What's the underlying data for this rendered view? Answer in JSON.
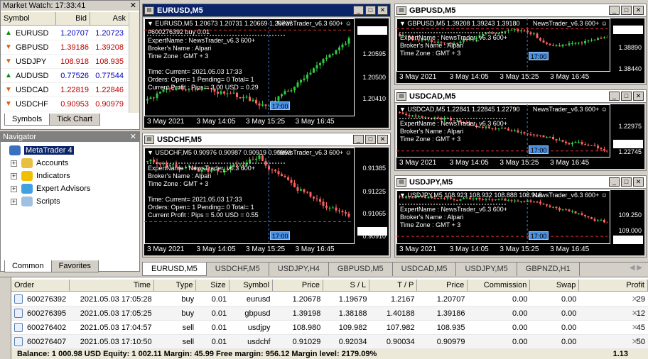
{
  "market_watch": {
    "title": "Market Watch: 17:33:41",
    "cols": {
      "symbol": "Symbol",
      "bid": "Bid",
      "ask": "Ask"
    },
    "rows": [
      {
        "symbol": "EURUSD",
        "bid": "1.20707",
        "ask": "1.20723",
        "dir": "up",
        "color": "#0000c0"
      },
      {
        "symbol": "GBPUSD",
        "bid": "1.39186",
        "ask": "1.39208",
        "dir": "down",
        "color": "#c00000"
      },
      {
        "symbol": "USDJPY",
        "bid": "108.918",
        "ask": "108.935",
        "dir": "down",
        "color": "#c00000"
      },
      {
        "symbol": "AUDUSD",
        "bid": "0.77526",
        "ask": "0.77544",
        "dir": "up",
        "color": "#0000c0"
      },
      {
        "symbol": "USDCAD",
        "bid": "1.22819",
        "ask": "1.22846",
        "dir": "down",
        "color": "#c00000"
      },
      {
        "symbol": "USDCHF",
        "bid": "0.90953",
        "ask": "0.90979",
        "dir": "down",
        "color": "#c00000"
      }
    ],
    "tabs": [
      "Symbols",
      "Tick Chart"
    ]
  },
  "navigator": {
    "title": "Navigator",
    "root": "MetaTrader 4",
    "items": [
      "Accounts",
      "Indicators",
      "Expert Advisors",
      "Scripts"
    ],
    "tabs": [
      "Common",
      "Favorites"
    ]
  },
  "charts": {
    "eurusd": {
      "title": "EURUSD,M5",
      "hdr": "EURUSD,M5  1.20673 1.20731 1.20669 1.20707",
      "ea": "NewsTrader_v6.3 600+ ☺",
      "order": "#600276392 buy 0.01",
      "lines": [
        "ExpertName : NewsTrader_v6.3 600+",
        "Broker's Name :  Alpari",
        "Time Zone : GMT + 3",
        "",
        "Time: Current= 2021.05.03 17:33",
        "Orders: Open= 1 Pending= 0 Total= 1",
        "Current Profit :  Pips = 3.00 USD = 0.29"
      ],
      "prices": [
        "1.20707",
        "1.20595",
        "1.20500",
        "1.20410"
      ],
      "tag": "17:00",
      "x": [
        "3 May 2021",
        "3 May 14:05",
        "3 May 15:25",
        "3 May 16:45"
      ]
    },
    "usdchf": {
      "title": "USDCHF,M5",
      "hdr": "USDCHF,M5  0.90976 0.90987 0.90919 0.90953",
      "ea": "NewsTrader_v6.3 600+ ☺",
      "lines": [
        "ExpertName : NewsTrader_v6.3 600+",
        "Broker's Name :  Alpari",
        "Time Zone : GMT + 3",
        "",
        "Time: Current= 2021.05.03 17:33",
        "Orders: Open= 1 Pending= 0 Total= 1",
        "Current Profit :  Pips = 5.00 USD = 0.55"
      ],
      "prices": [
        "0.91385",
        "0.91225",
        "0.91065",
        "0.90953",
        "0.90910"
      ],
      "tag": "17:00",
      "x": [
        "3 May 2021",
        "3 May 14:05",
        "3 May 15:25",
        "3 May 16:45"
      ]
    },
    "gbpusd": {
      "title": "GBPUSD,M5",
      "hdr": "GBPUSD,M5  1.39208 1.39243 1.39180",
      "ea": "NewsTrader_v6.3 600+ ☺",
      "lines": [
        "ExpertName : NewsTrader_v6.3 600+",
        "Broker's Name :  Alpari",
        "Time Zone : GMT + 3"
      ],
      "prices": [
        "1.39186",
        "1.38890",
        "1.38440"
      ],
      "tag": "17:00",
      "x": [
        "3 May 2021",
        "3 May 14:05",
        "3 May 15:25",
        "3 May 16:45"
      ]
    },
    "usdcad": {
      "title": "USDCAD,M5",
      "hdr": "USDCAD,M5  1.22841 1.22845 1.22790",
      "ea": "NewsTrader_v6.3 600+ ☺",
      "lines": [
        "ExpertName : NewsTrader_v6.3 600+",
        "Broker's Name :  Alpari",
        "Time Zone : GMT + 3"
      ],
      "prices": [
        "1.22975",
        "1.22819",
        "1.22745"
      ],
      "tag": "17:00",
      "x": [
        "3 May 2021",
        "3 May 14:05",
        "3 May 15:25",
        "3 May 16:45"
      ]
    },
    "usdjpy": {
      "title": "USDJPY,M5",
      "hdr": "USDJPY,M5  108.923 108.932 108.888 108.918",
      "ea": "NewsTrader_v6.3 600+ ☺",
      "lines": [
        "ExpertName : NewsTrader_v6.3 600+",
        "Broker's Name :  Alpari",
        "Time Zone : GMT + 3"
      ],
      "prices": [
        "109.250",
        "109.000",
        "108.918"
      ],
      "tag": "17:00",
      "x": [
        "3 May 2021",
        "3 May 14:05",
        "3 May 15:25",
        "3 May 16:45"
      ]
    }
  },
  "chart_tabs": [
    "EURUSD,M5",
    "USDCHF,M5",
    "USDJPY,H4",
    "GBPUSD,M5",
    "USDCAD,M5",
    "USDJPY,M5",
    "GBPNZD,H1"
  ],
  "terminal": {
    "cols": [
      "Order",
      "Time",
      "Type",
      "Size",
      "Symbol",
      "Price",
      "S / L",
      "T / P",
      "Price",
      "Commission",
      "Swap",
      "Profit"
    ],
    "rows": [
      [
        "600276392",
        "2021.05.03 17:05:28",
        "buy",
        "0.01",
        "eurusd",
        "1.20678",
        "1.19679",
        "1.2167",
        "1.20707",
        "0.00",
        "0.00",
        "29"
      ],
      [
        "600276395",
        "2021.05.03 17:05:25",
        "buy",
        "0.01",
        "gbpusd",
        "1.39198",
        "1.38188",
        "1.40188",
        "1.39186",
        "0.00",
        "0.00",
        "-12"
      ],
      [
        "600276402",
        "2021.05.03 17:04:57",
        "sell",
        "0.01",
        "usdjpy",
        "108.980",
        "109.982",
        "107.982",
        "108.935",
        "0.00",
        "0.00",
        "45"
      ],
      [
        "600276407",
        "2021.05.03 17:10:50",
        "sell",
        "0.01",
        "usdchf",
        "0.91029",
        "0.92034",
        "0.90034",
        "0.90979",
        "0.00",
        "0.00",
        "50"
      ]
    ],
    "balance": "Balance: 1 000.98 USD  Equity: 1 002.11  Margin: 45.99  Free margin: 956.12  Margin level: 2179.09%",
    "total": "1.13"
  },
  "colors": {
    "up": "#0a8a0a",
    "down": "#e06010",
    "bull": "#2ecc40",
    "bear": "#ff6060"
  }
}
